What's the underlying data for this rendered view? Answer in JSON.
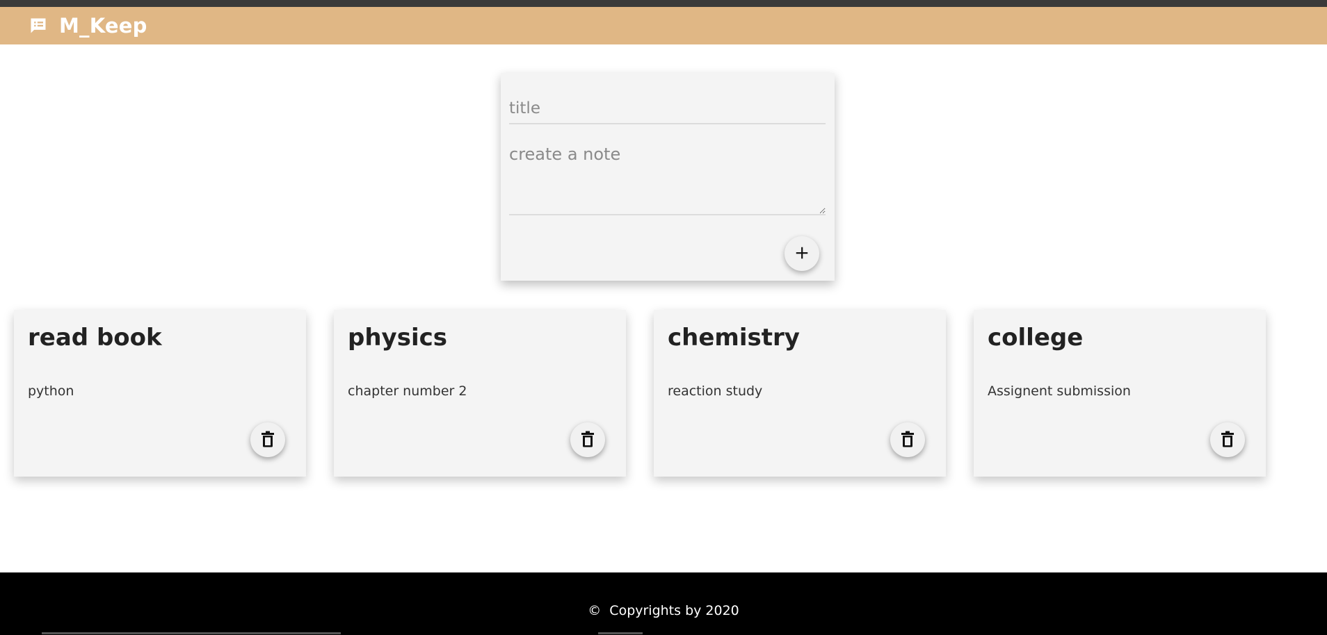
{
  "header": {
    "app_title": "M_Keep",
    "logo_icon": "notes-icon",
    "background_color": "#e0b785"
  },
  "composer": {
    "title_placeholder": "title",
    "note_placeholder": "create a note",
    "add_icon": "plus-icon"
  },
  "notes": [
    {
      "title": "read book",
      "content": "python"
    },
    {
      "title": "physics",
      "content": "chapter number 2"
    },
    {
      "title": "chemistry",
      "content": "reaction study"
    },
    {
      "title": "college",
      "content": "Assignent submission"
    }
  ],
  "note_actions": {
    "delete_icon": "trash-icon"
  },
  "footer": {
    "copyright_symbol": "©",
    "copyright_text": "Copyrights by 2020"
  }
}
